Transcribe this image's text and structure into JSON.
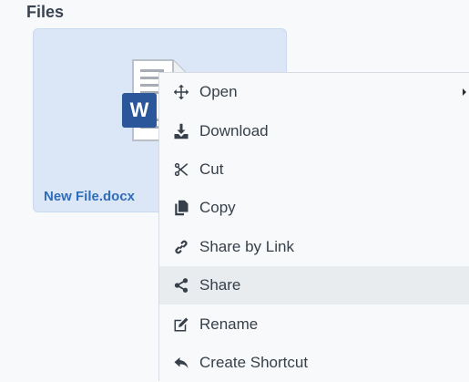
{
  "section": {
    "title": "Files"
  },
  "file": {
    "name": "New File.docx",
    "icon": "word-document-icon",
    "accent_color": "#2b579a"
  },
  "context_menu": {
    "items": [
      {
        "label": "Open",
        "icon": "move-arrows-icon",
        "has_submenu": true
      },
      {
        "label": "Download",
        "icon": "download-icon"
      },
      {
        "label": "Cut",
        "icon": "scissors-icon"
      },
      {
        "label": "Copy",
        "icon": "copy-icon"
      },
      {
        "label": "Share by Link",
        "icon": "link-icon"
      },
      {
        "label": "Share",
        "icon": "share-icon",
        "highlighted": true
      },
      {
        "label": "Rename",
        "icon": "rename-icon"
      },
      {
        "label": "Create Shortcut",
        "icon": "reply-arrow-icon"
      }
    ]
  },
  "colors": {
    "card_bg": "#dbe7f7",
    "link": "#2f6db8",
    "text": "#37404a",
    "hover": "#e9ecef"
  }
}
